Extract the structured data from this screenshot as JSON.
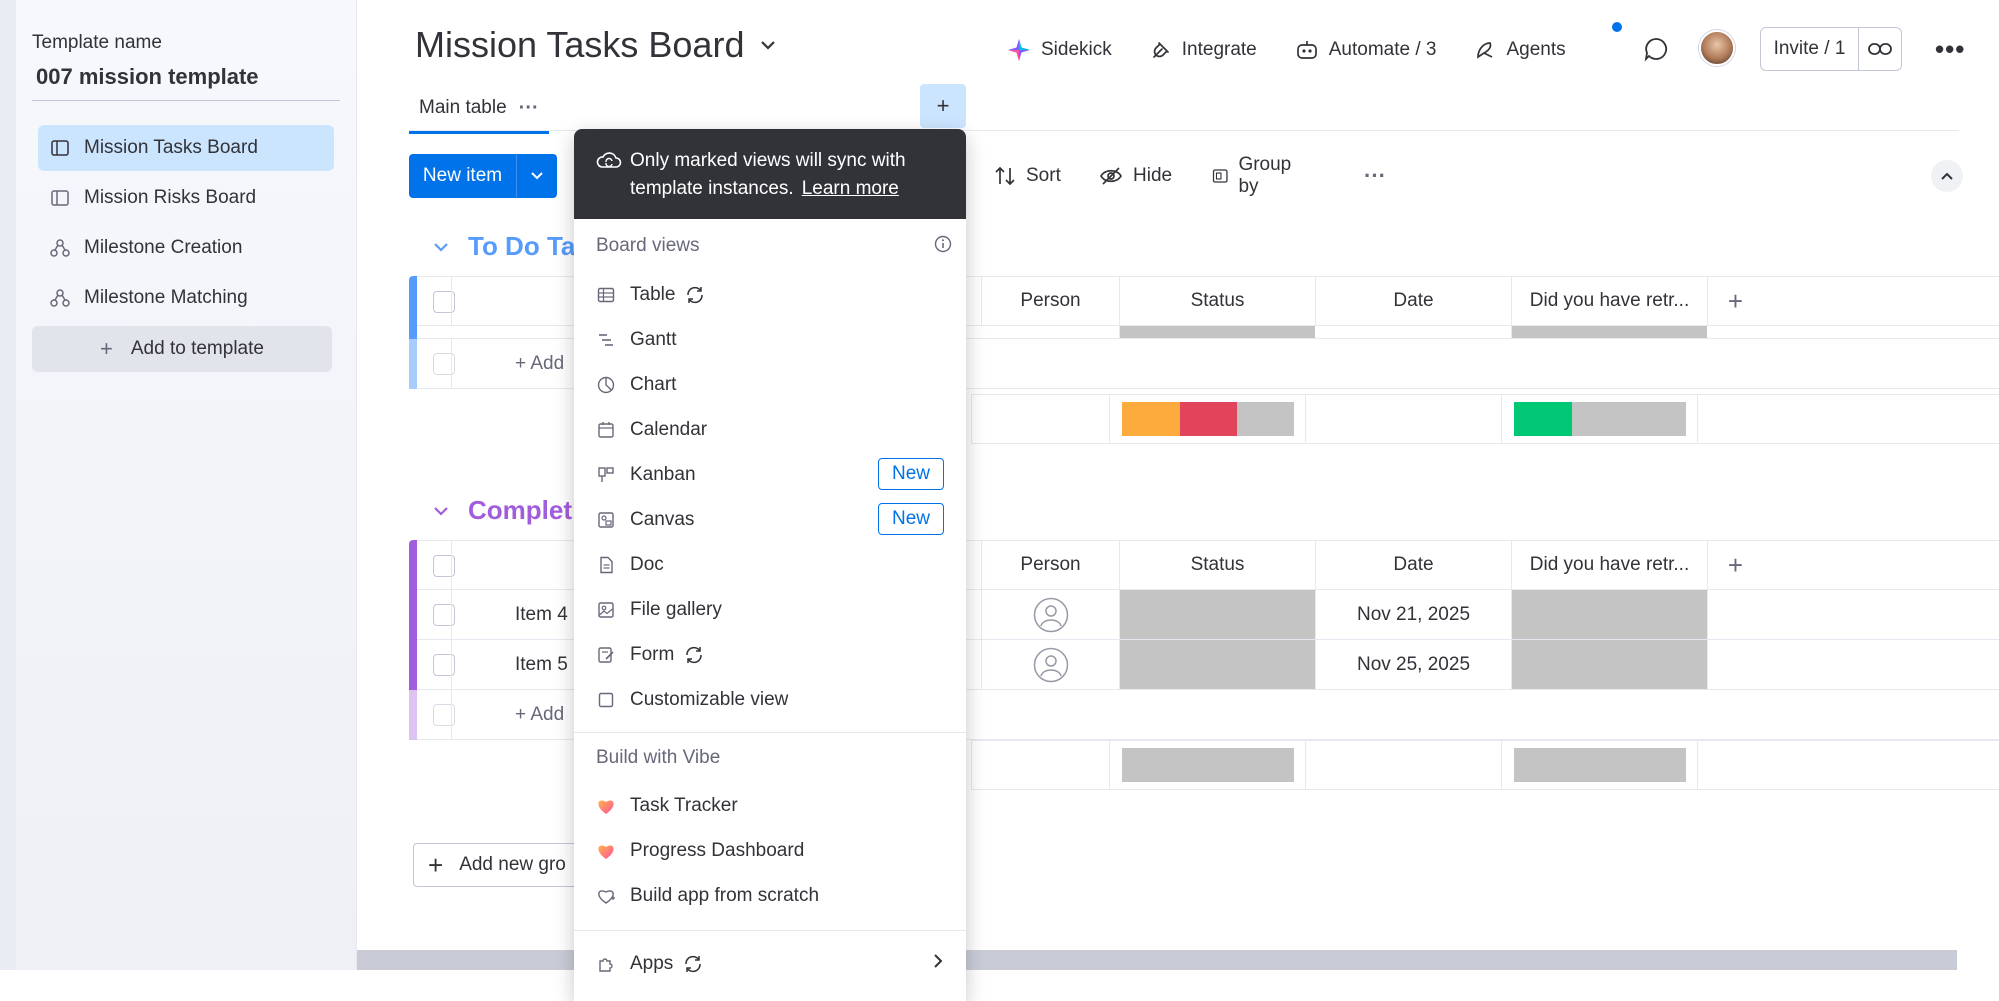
{
  "template": {
    "label": "Template name",
    "name": "007 mission template",
    "items": [
      {
        "label": "Mission Tasks Board",
        "icon": "board-icon"
      },
      {
        "label": "Mission Risks Board",
        "icon": "board-icon"
      },
      {
        "label": "Milestone Creation",
        "icon": "workflow-icon"
      },
      {
        "label": "Milestone Matching",
        "icon": "workflow-icon"
      }
    ],
    "add_label": "Add to template"
  },
  "header": {
    "title": "Mission Tasks Board",
    "actions": {
      "sidekick": "Sidekick",
      "integrate": "Integrate",
      "automate": "Automate / 3",
      "agents": "Agents"
    },
    "invite": "Invite / 1"
  },
  "tabs": {
    "main": "Main table"
  },
  "toolbar": {
    "new_item": "New item",
    "sort": "Sort",
    "hide": "Hide",
    "group_by": "Group by"
  },
  "groups": [
    {
      "title": "To Do Ta",
      "color": "#579bfc",
      "columns": [
        "Person",
        "Status",
        "Date",
        "Did you have retr..."
      ],
      "add_item": "+ Add"
    },
    {
      "title": "Complet",
      "color": "#a25ddc",
      "columns": [
        "Person",
        "Status",
        "Date",
        "Did you have retr..."
      ],
      "rows": [
        {
          "item": "Item 4",
          "date": "Nov 21, 2025"
        },
        {
          "item": "Item 5",
          "date": "Nov 25, 2025"
        }
      ],
      "add_item": "+ Add"
    }
  ],
  "add_group": "Add new gro",
  "colors": {
    "primary": "#0073ea",
    "status_orange": "#fdab3d",
    "status_red": "#e2445c",
    "status_green": "#00c875",
    "status_grey": "#c4c4c4"
  },
  "popover": {
    "banner": "Only marked views will sync with template instances.",
    "learn_more": "Learn more",
    "board_views_title": "Board views",
    "board_views": [
      {
        "label": "Table",
        "icon": "table-icon",
        "sync": true
      },
      {
        "label": "Gantt",
        "icon": "gantt-icon"
      },
      {
        "label": "Chart",
        "icon": "chart-icon"
      },
      {
        "label": "Calendar",
        "icon": "calendar-icon"
      },
      {
        "label": "Kanban",
        "icon": "kanban-icon",
        "badge": "New"
      },
      {
        "label": "Canvas",
        "icon": "canvas-icon",
        "badge": "New"
      },
      {
        "label": "Doc",
        "icon": "doc-icon"
      },
      {
        "label": "File gallery",
        "icon": "file-gallery-icon"
      },
      {
        "label": "Form",
        "icon": "form-icon",
        "sync": true
      },
      {
        "label": "Customizable view",
        "icon": "customizable-view-icon"
      }
    ],
    "vibe_title": "Build with Vibe",
    "vibe_items": [
      {
        "label": "Task Tracker",
        "icon": "heart-icon"
      },
      {
        "label": "Progress Dashboard",
        "icon": "heart-icon"
      },
      {
        "label": "Build app from scratch",
        "icon": "heart-outline-icon"
      }
    ],
    "apps_label": "Apps"
  }
}
